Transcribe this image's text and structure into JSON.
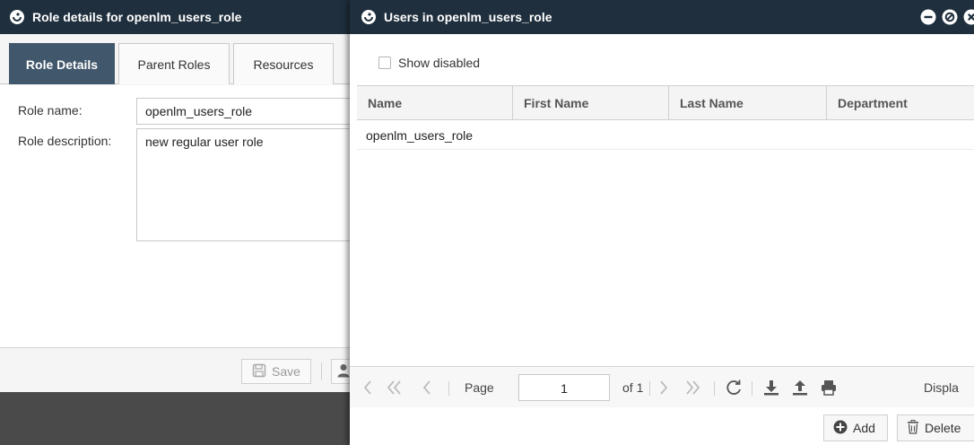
{
  "left_window": {
    "title": "Role details for openlm_users_role",
    "tabs": [
      {
        "label": "Role Details",
        "active": true
      },
      {
        "label": "Parent Roles",
        "active": false
      },
      {
        "label": "Resources",
        "active": false
      }
    ],
    "form": {
      "role_name_label": "Role name:",
      "role_name_value": "openlm_users_role",
      "role_description_label": "Role description:",
      "role_description_value": "new regular user role"
    },
    "footer": {
      "save_label": "Save"
    }
  },
  "right_window": {
    "title": "Users in openlm_users_role",
    "show_disabled_label": "Show disabled",
    "show_disabled_checked": false,
    "grid": {
      "columns": [
        "Name",
        "First Name",
        "Last Name",
        "Department"
      ],
      "rows": [
        [
          "openlm_users_role",
          "",
          "",
          ""
        ]
      ]
    },
    "pager": {
      "page_label": "Page",
      "page_value": "1",
      "of_label": "of 1",
      "display_partial": "Displa"
    },
    "actions": {
      "add_label": "Add",
      "delete_label": "Delete"
    }
  },
  "colors": {
    "titlebar": "#1f2f3d",
    "active_tab": "#41576b",
    "desktop": "#4a4a4a"
  }
}
